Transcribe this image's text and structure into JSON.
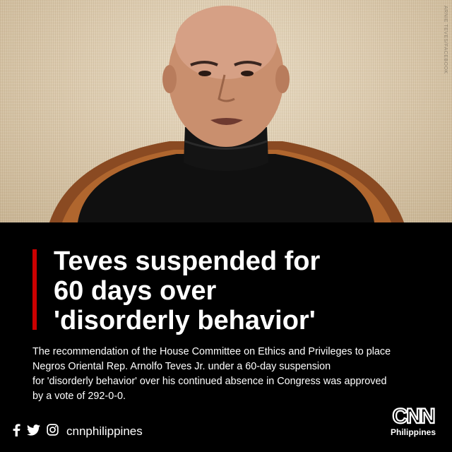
{
  "post": {
    "photo_credit": "ARNIE TEVES/FACEBOOK",
    "headline_lines": [
      "Teves suspended for",
      "60 days over",
      "'disorderly behavior'"
    ],
    "body_lines": [
      "The recommendation of the House Committee on Ethics and Privileges to place",
      "Negros Oriental Rep. Arnolfo Teves Jr. under a 60-day suspension",
      "for 'disorderly behavior' over his continued absence in Congress was approved",
      "by a vote of 292-0-0."
    ],
    "social": {
      "icons": [
        "facebook-icon",
        "twitter-icon",
        "instagram-icon"
      ],
      "handle": "cnnphilippines"
    },
    "logo": {
      "wordmark": "CNN",
      "subtitle": "Philippines"
    },
    "colors": {
      "accent": "#cc0000",
      "panel_bg": "#000000",
      "text": "#ffffff"
    }
  }
}
